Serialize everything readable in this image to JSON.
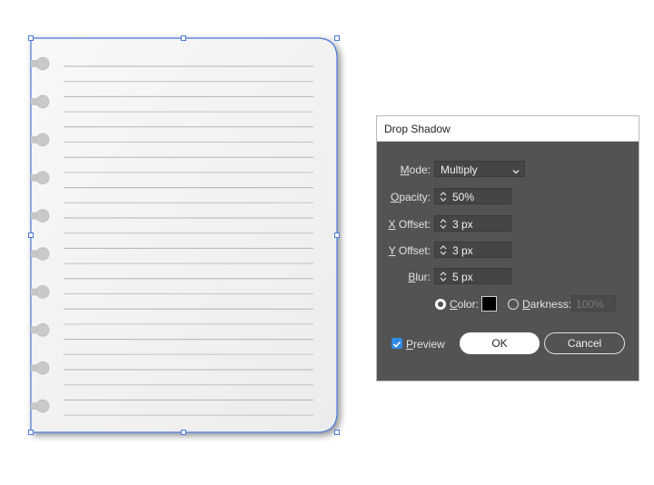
{
  "dialog": {
    "title": "Drop Shadow",
    "mode": {
      "label": "Mode:",
      "value": "Multiply"
    },
    "opacity": {
      "label": "Opacity:",
      "value": "50%"
    },
    "x_offset": {
      "label": "X Offset:",
      "value": "3 px"
    },
    "y_offset": {
      "label": "Y Offset:",
      "value": "3 px"
    },
    "blur": {
      "label": "Blur:",
      "value": "5 px"
    },
    "color_option": {
      "label": "Color:",
      "selected": true,
      "swatch": "#000000"
    },
    "darkness_option": {
      "label": "Darkness:",
      "value": "100%",
      "selected": false
    },
    "preview": {
      "label": "Preview",
      "checked": true
    },
    "ok_label": "OK",
    "cancel_label": "Cancel"
  },
  "colors": {
    "dialog_bg": "#535353",
    "highlight": "#e81ce4",
    "selection": "#4a78d6",
    "checkbox": "#2f8ae5"
  }
}
